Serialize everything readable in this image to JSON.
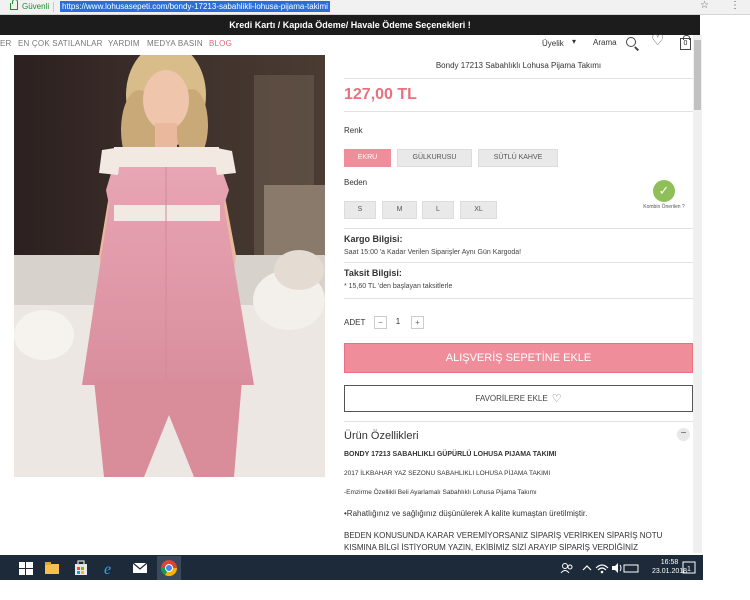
{
  "browser": {
    "secure_label": "Güvenli",
    "url": "https://www.lohusasepeti.com/bondy-17213-sabahlikli-lohusa-pijama-takimi",
    "star_icon": "☆",
    "menu_icon": "⋮"
  },
  "promo": {
    "text": "Kredi Kartı / Kapıda Ödeme/ Havale Ödeme Seçenekleri !"
  },
  "nav": {
    "items": [
      "ER",
      "EN ÇOK SATILANLAR",
      "YARDIM",
      "MEDYA BASIN",
      "BLOG"
    ],
    "account_label": "Üyelik",
    "account_chevron": "▾",
    "search_label": "Arama",
    "heart_icon": "♡",
    "cart_count": "0"
  },
  "product": {
    "title": "Bondy 17213 Sabahlıklı Lohusa Pijama Takımı",
    "price": "127,00 TL",
    "color_label": "Renk",
    "colors": [
      "EKRU",
      "GÜLKURUSU",
      "SÜTLÜ KAHVE"
    ],
    "size_label": "Beden",
    "sizes": [
      "S",
      "M",
      "L",
      "XL"
    ],
    "badge_check": "✓",
    "badge_text": "Kombin Önerilen ?",
    "shipping_title": "Kargo Bilgisi:",
    "shipping_text": "Saat 15:00 'a Kadar Verilen Siparişler Aynı Gün Kargoda!",
    "installment_title": "Taksit Bilgisi:",
    "installment_text": "* 15,60 TL 'den başlayan taksitlerle",
    "qty_label": "ADET",
    "qty_minus": "−",
    "qty_value": "1",
    "qty_plus": "+",
    "add_to_cart": "ALIŞVERİŞ SEPETİNE EKLE",
    "favorite_label": "FAVORİLERE EKLE",
    "favorite_heart": "♡"
  },
  "features": {
    "title": "Ürün Özellikleri",
    "collapse_icon": "−",
    "heading": "BONDY 17213 SABAHLIKLI GÜPÜRLÜ LOHUSA PIJAMA TAKIMI",
    "line1": "2017 İLKBAHAR YAZ SEZONU SABAHLIKLI LOHUSA PİJAMA TAKIMI",
    "line2": "-Emzirme Özellikli Beli Ayarlamalı Sabahlıklı Lohusa Pijama Takımı",
    "line3": "•Rahatlığınız ve sağlığınız düşünülerek A kalite kumaştan üretilmiştir.",
    "line4": "BEDEN KONUSUNDA KARAR VEREMİYORSANIZ SİPARİŞ VERİRKEN SİPARİŞ NOTU",
    "line5": "KISMINA BİLGİ İSTİYORUM YAZIN, EKİBİMİZ SİZİ ARAYIP SİPARİŞ VERDİĞİNİZ"
  },
  "taskbar": {
    "time": "16:58",
    "date": "23.01.2018"
  },
  "colors": {
    "accent": "#f08d9a",
    "price": "#e8707f",
    "promo_bg": "#1c1c1c",
    "taskbar_bg": "#1c2a3a"
  }
}
